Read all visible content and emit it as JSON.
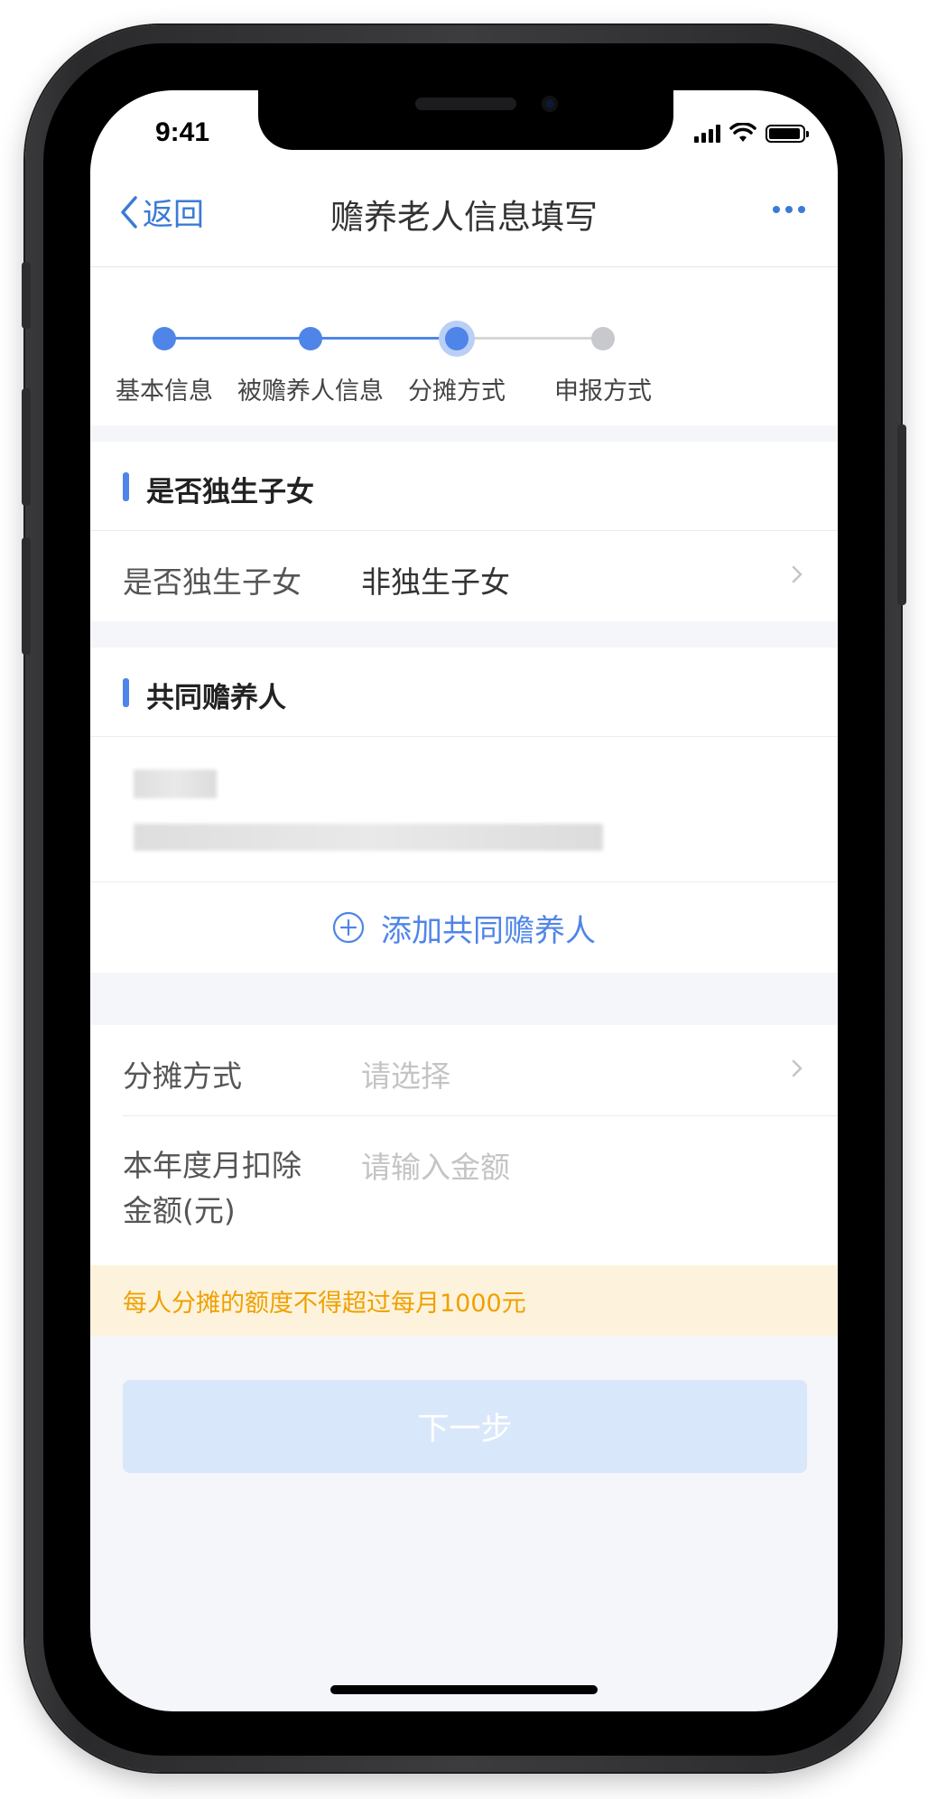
{
  "status_bar": {
    "time": "9:41"
  },
  "nav": {
    "back_label": "返回",
    "title": "赡养老人信息填写"
  },
  "stepper": {
    "steps": [
      {
        "label": "基本信息",
        "state": "done"
      },
      {
        "label": "被赡养人信息",
        "state": "done"
      },
      {
        "label": "分摊方式",
        "state": "current"
      },
      {
        "label": "申报方式",
        "state": "todo"
      }
    ]
  },
  "only_child_section": {
    "title": "是否独生子女",
    "row": {
      "label": "是否独生子女",
      "value": "非独生子女"
    }
  },
  "co_supporter_section": {
    "title": "共同赡养人",
    "add_label": "添加共同赡养人"
  },
  "allocation": {
    "method_label": "分摊方式",
    "method_placeholder": "请选择",
    "amount_label_line1": "本年度月扣除",
    "amount_label_line2": "金额(元)",
    "amount_placeholder": "请输入金额"
  },
  "notice": {
    "text": "每人分摊的额度不得超过每月1000元"
  },
  "next_button": {
    "label": "下一步"
  },
  "colors": {
    "accent": "#4f85e8",
    "nav_link": "#3a7bd5",
    "notice_bg": "#fdf3dc",
    "notice_text": "#f0a000",
    "disabled_button": "#d9e7fa"
  }
}
